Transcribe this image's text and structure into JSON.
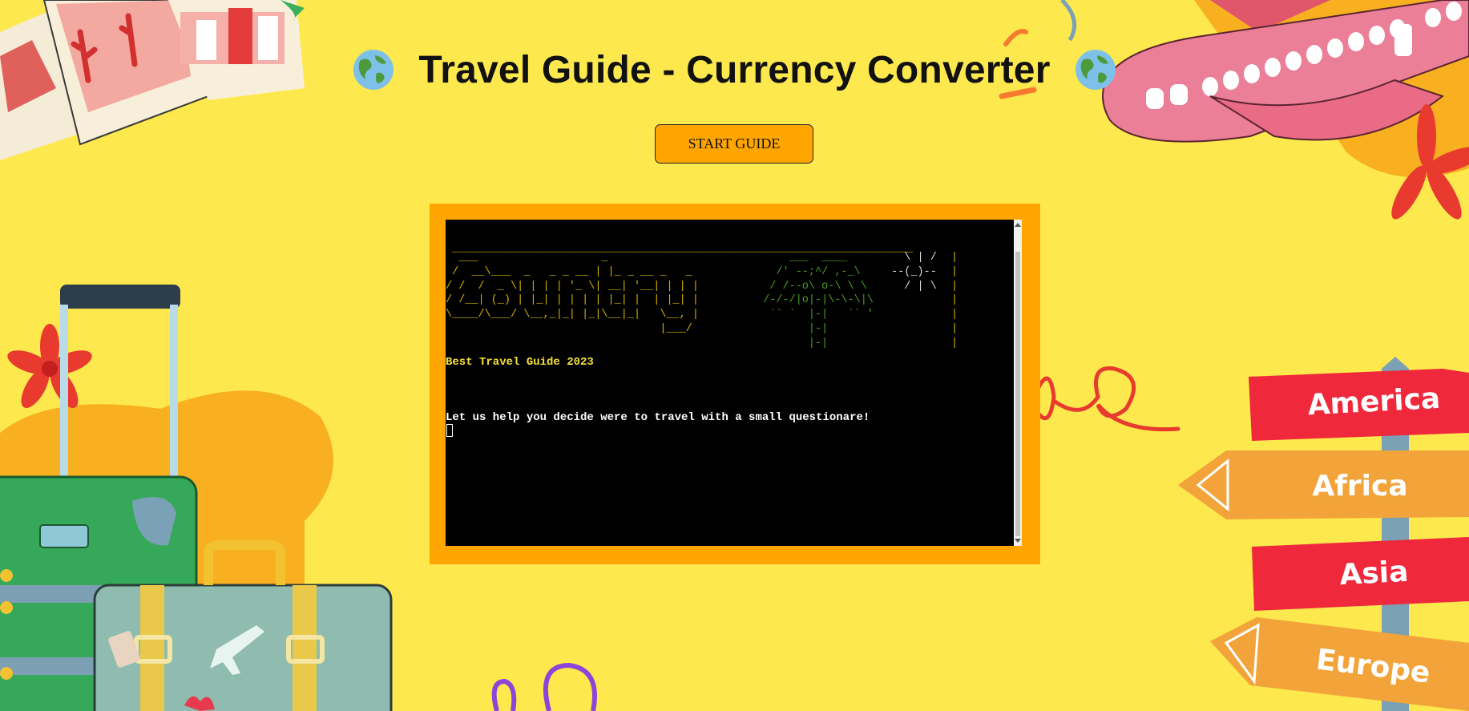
{
  "header": {
    "title": "Travel Guide - Currency Converter",
    "left_icon": "globe-icon",
    "right_icon": "globe-icon"
  },
  "start_button": {
    "label": "START GUIDE"
  },
  "terminal": {
    "ascii_rule": " _______________________________________________________________________",
    "ascii_country": "  ___                   _\n /  __\\___  _   _ _ __ | |_ _ __ _   _\n/ /  /  _ \\| | | | '_ \\| __| '__| | | |\n/ /__| (_) | |_| | | | | |_| |  | |_| |\n\\____/\\___/ \\__,_|_| |_|\\__|_|   \\__, |\n                                 |___/",
    "ascii_tree": "      ___  ____\n    /' --;^/ ,-_\\\n   / /--o\\ o-\\ \\ \\\n  /-/-/|o|-|\\-\\-\\|\\\n   `` `  |-|   `` '\n         |-|\n         |-|",
    "ascii_sun": "   \\ | /\n --(_)--\n   / | \\",
    "ascii_side": "|\n|\n|\n|\n|\n|\n|",
    "tagline": "Best Travel Guide 2023",
    "intro": "Let us help you decide were to travel with a small questionare!"
  },
  "signpost": {
    "signs": [
      "America",
      "Africa",
      "Asia",
      "Europe"
    ]
  },
  "colors": {
    "background": "#fde84d",
    "accent": "#ffa500",
    "terminal_bg": "#000000"
  }
}
